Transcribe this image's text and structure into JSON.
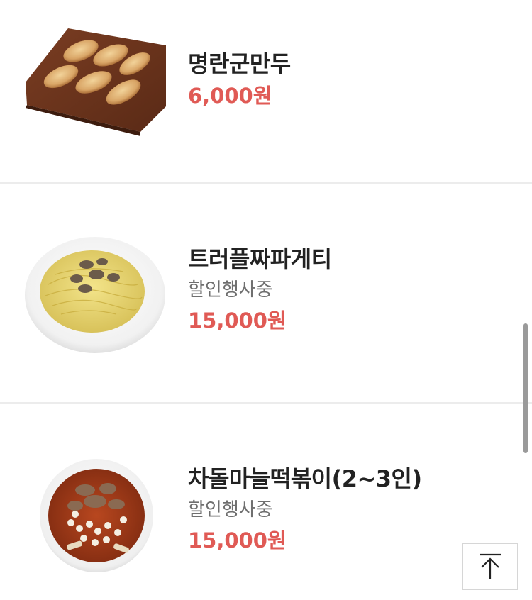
{
  "menu": {
    "items": [
      {
        "name": "명란군만두",
        "price": "6,000원"
      },
      {
        "name": "트러플짜파게티",
        "badge": "할인행사중",
        "price": "15,000원"
      },
      {
        "name": "차돌마늘떡볶이(2~3인)",
        "badge": "할인행사중",
        "price": "15,000원"
      }
    ]
  },
  "icons": {
    "scroll_to_top": "arrow-up-to-line-icon"
  },
  "colors": {
    "price": "#e05a55",
    "name": "#222222",
    "badge": "#6f6f6f",
    "divider": "#ececec"
  }
}
